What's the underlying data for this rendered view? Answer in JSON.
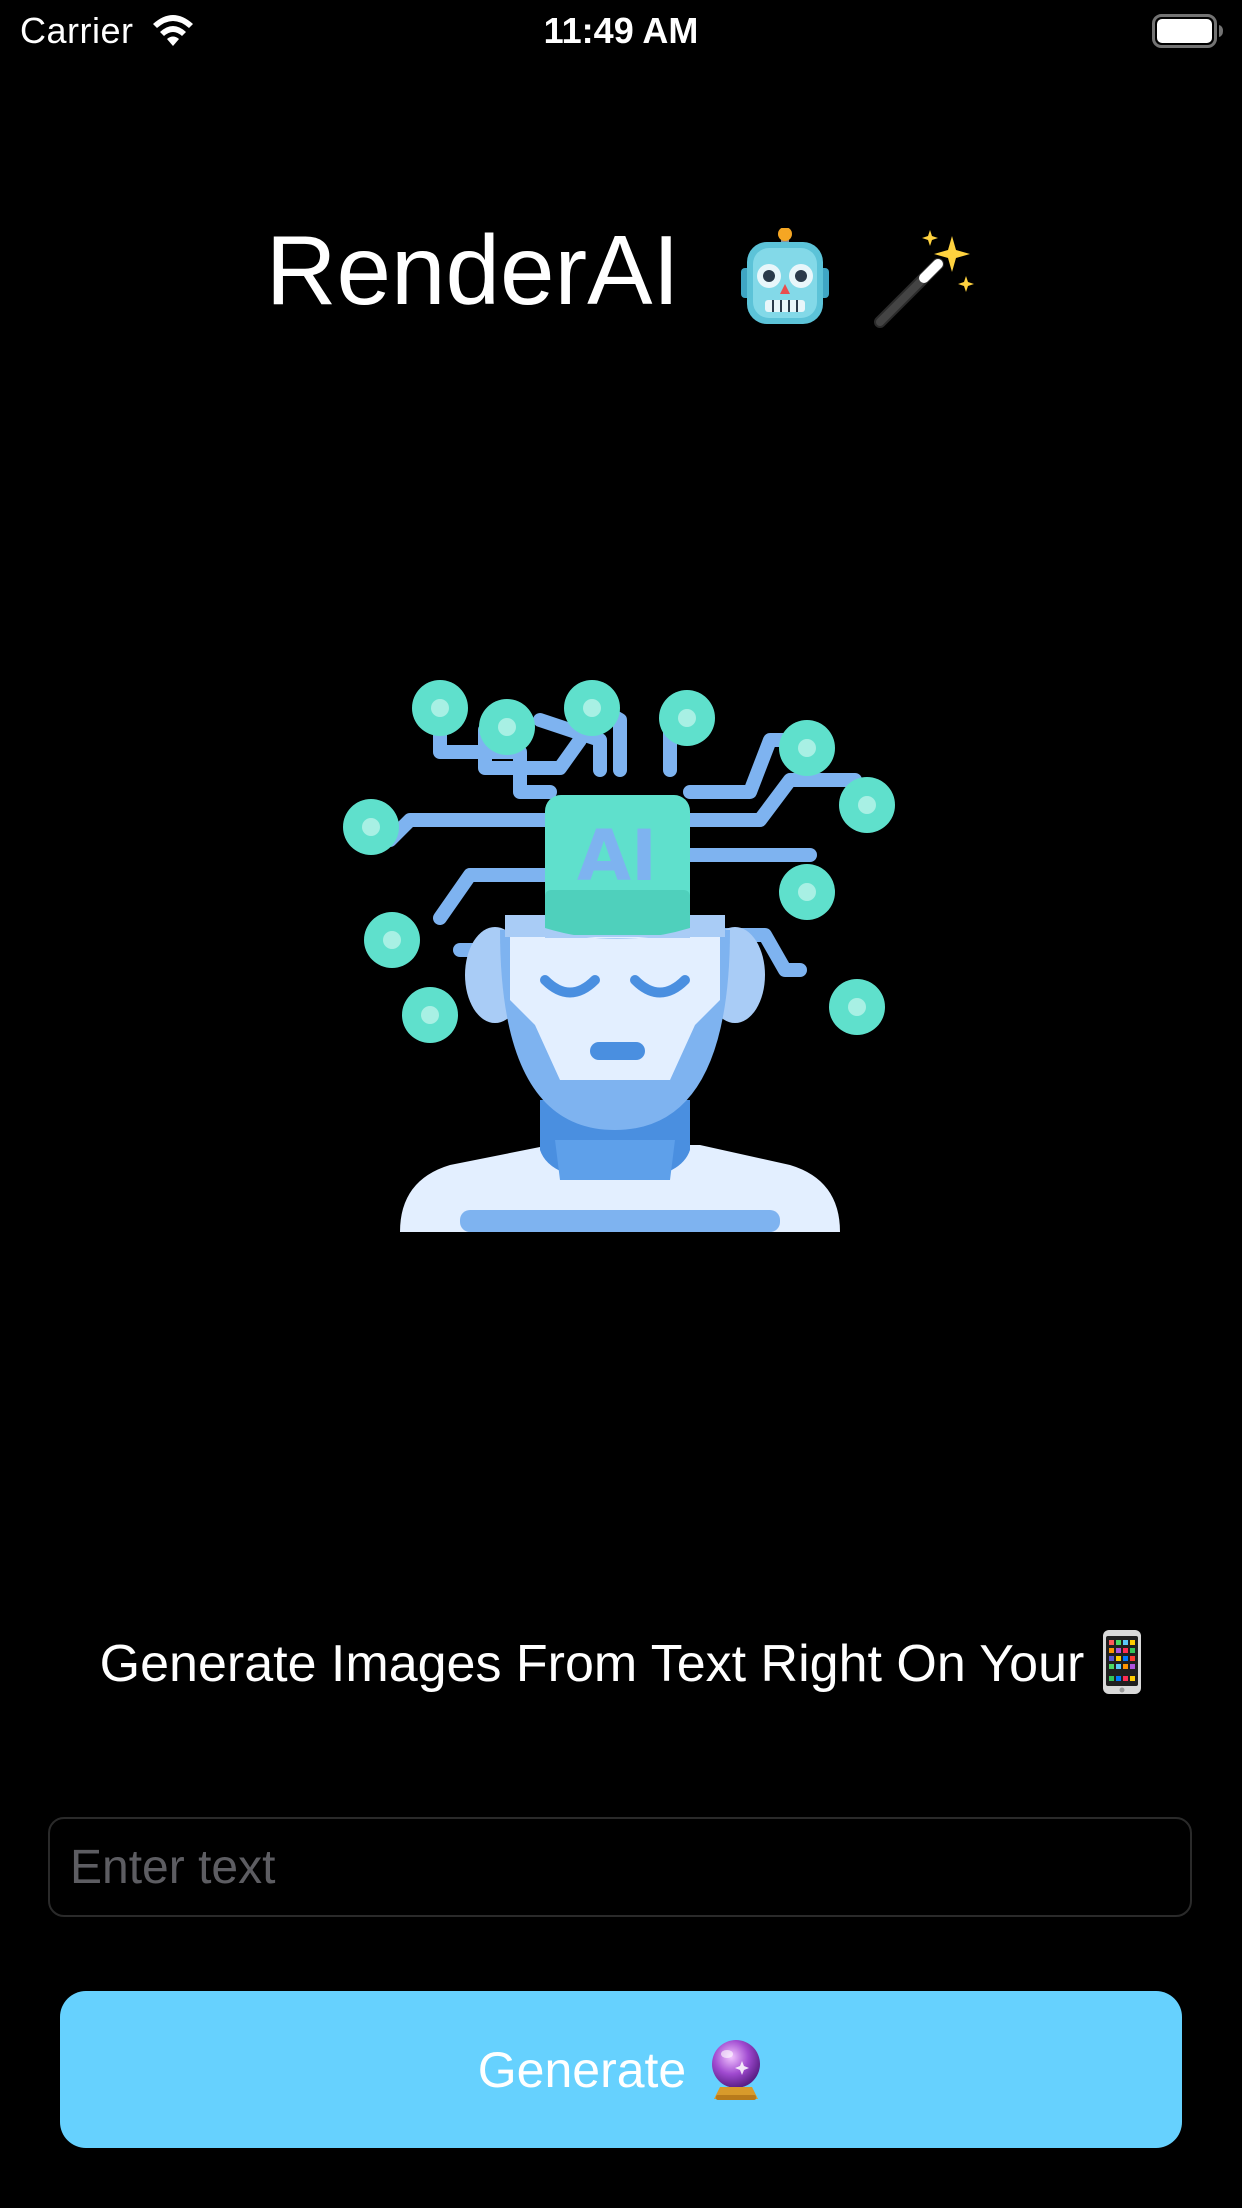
{
  "status_bar": {
    "carrier": "Carrier",
    "time": "11:49 AM",
    "icons": [
      "wifi-icon",
      "battery-icon"
    ]
  },
  "header": {
    "title": "RenderAI",
    "title_emojis": [
      "robot-icon",
      "magic-wand-icon"
    ]
  },
  "hero": {
    "illustration": "ai-head-circuit-illustration",
    "badge_text": "AI"
  },
  "main": {
    "tagline": "Generate Images From Text Right On Your",
    "tagline_emoji": "mobile-phone-icon",
    "input": {
      "value": "",
      "placeholder": "Enter text"
    },
    "generate_button": {
      "label": "Generate",
      "emoji": "crystal-ball-icon"
    }
  },
  "colors": {
    "background": "#000000",
    "button": "#66d1fe",
    "placeholder": "#5d5d62",
    "input_border": "#2a2a2a",
    "hero_teal": "#5fe0cc",
    "hero_blue": "#7eb3f0"
  }
}
